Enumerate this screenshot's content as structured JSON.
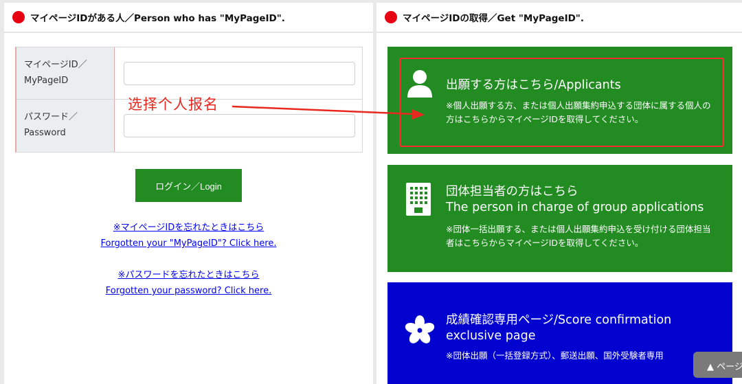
{
  "left_panel": {
    "title": "マイページIDがある人／Person who has \"MyPageID\".",
    "id_label_1": "マイページID／",
    "id_label_2": "MyPageID",
    "pw_label_1": "パスワード／",
    "pw_label_2": "Password",
    "id_value": "",
    "pw_value": "",
    "login_button": "ログイン／Login",
    "forgot_id_jp": "※マイページIDを忘れたときはこちら",
    "forgot_id_en": "Forgotten your \"MyPageID\"? Click here.",
    "forgot_pw_jp": "※パスワードを忘れたときはこちら",
    "forgot_pw_en": "Forgotten your password? Click here."
  },
  "annotation": {
    "text": "选择个人报名",
    "color": "#e8271e"
  },
  "right_panel": {
    "title": "マイページIDの取得／Get \"MyPageID\".",
    "cards": [
      {
        "icon": "person-icon",
        "color": "#228b22",
        "title": "出願する方はこちら/Applicants",
        "desc": "※個人出願する方、または個人出願集約申込する団体に属する個人の方はこちらからマイページIDを取得してください。"
      },
      {
        "icon": "building-icon",
        "color": "#228b22",
        "title_line1": "団体担当者の方はこちら",
        "title_line2": "The person in charge of group applications",
        "desc": "※団体一括出願する、または個人出願集約申込を受け付ける団体担当者はこちらからマイページIDを取得してください。"
      },
      {
        "icon": "sakura-icon",
        "color": "#0303cf",
        "title": "成績確認専用ページ/Score confirmation exclusive page",
        "desc": "※団体出願（一括登録方式）、郵送出願、国外受験者専用"
      }
    ]
  },
  "scroll_top": "▲ ページ",
  "colors": {
    "accent_red": "#e60012",
    "green": "#228b22",
    "blue": "#0303cf",
    "link": "#0000ee"
  }
}
